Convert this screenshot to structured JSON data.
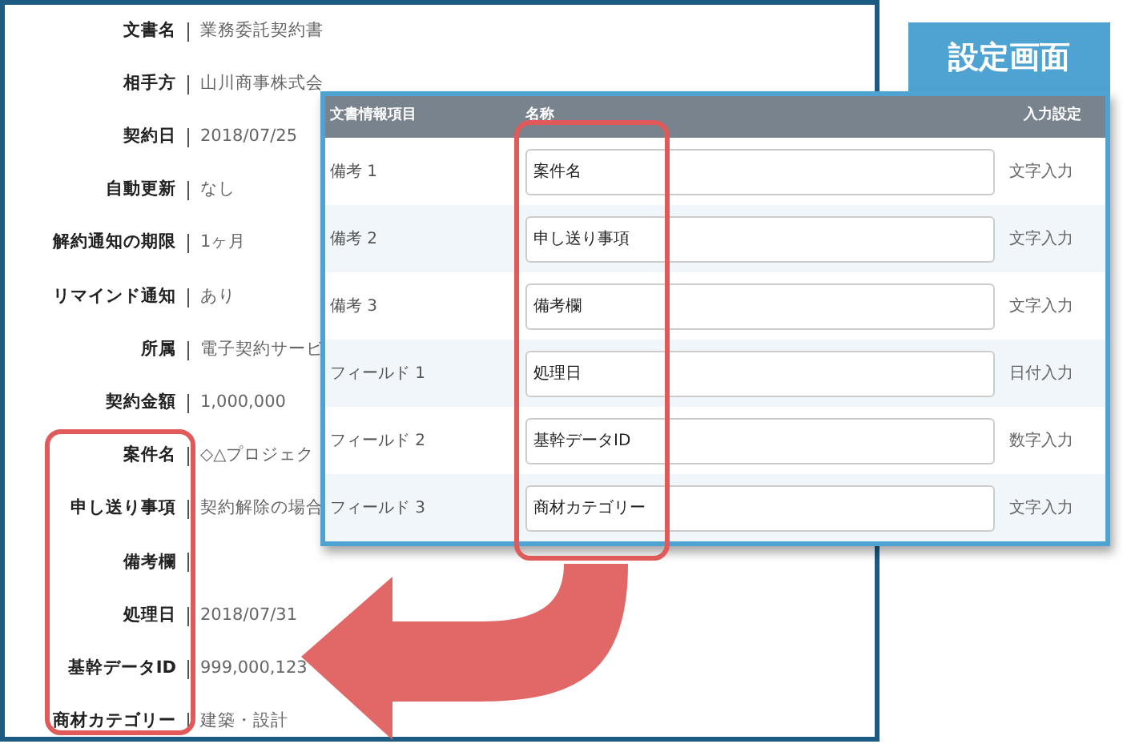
{
  "document_fields": [
    {
      "label": "文書名",
      "value": "業務委託契約書"
    },
    {
      "label": "相手方",
      "value": "山川商事株式会"
    },
    {
      "label": "契約日",
      "value": "2018/07/25"
    },
    {
      "label": "自動更新",
      "value": "なし"
    },
    {
      "label": "解約通知の期限",
      "value": "1ヶ月"
    },
    {
      "label": "リマインド通知",
      "value": "あり"
    },
    {
      "label": "所属",
      "value": "電子契約サービ"
    },
    {
      "label": "契約金額",
      "value": "1,000,000"
    },
    {
      "label": "案件名",
      "value": "◇△プロジェク"
    },
    {
      "label": "申し送り事項",
      "value": "契約解除の場合"
    },
    {
      "label": "備考欄"
    },
    {
      "label": "処理日",
      "value": "2018/07/31"
    },
    {
      "label": "基幹データID",
      "value": "999,000,123"
    },
    {
      "label": "商材カテゴリー",
      "value": "建築・設計"
    }
  ],
  "settings": {
    "badge": "設定画面",
    "columns": [
      "文書情報項目",
      "名称",
      "入力設定"
    ],
    "rows": [
      {
        "item": "備考 1",
        "name": "案件名",
        "input_type": "文字入力"
      },
      {
        "item": "備考 2",
        "name": "申し送り事項",
        "input_type": "文字入力"
      },
      {
        "item": "備考 3",
        "name": "備考欄",
        "input_type": "文字入力"
      },
      {
        "item": "フィールド 1",
        "name": "処理日",
        "input_type": "日付入力"
      },
      {
        "item": "フィールド 2",
        "name": "基幹データID",
        "input_type": "数字入力"
      },
      {
        "item": "フィールド 3",
        "name": "商材カテゴリー",
        "input_type": "文字入力"
      }
    ]
  }
}
